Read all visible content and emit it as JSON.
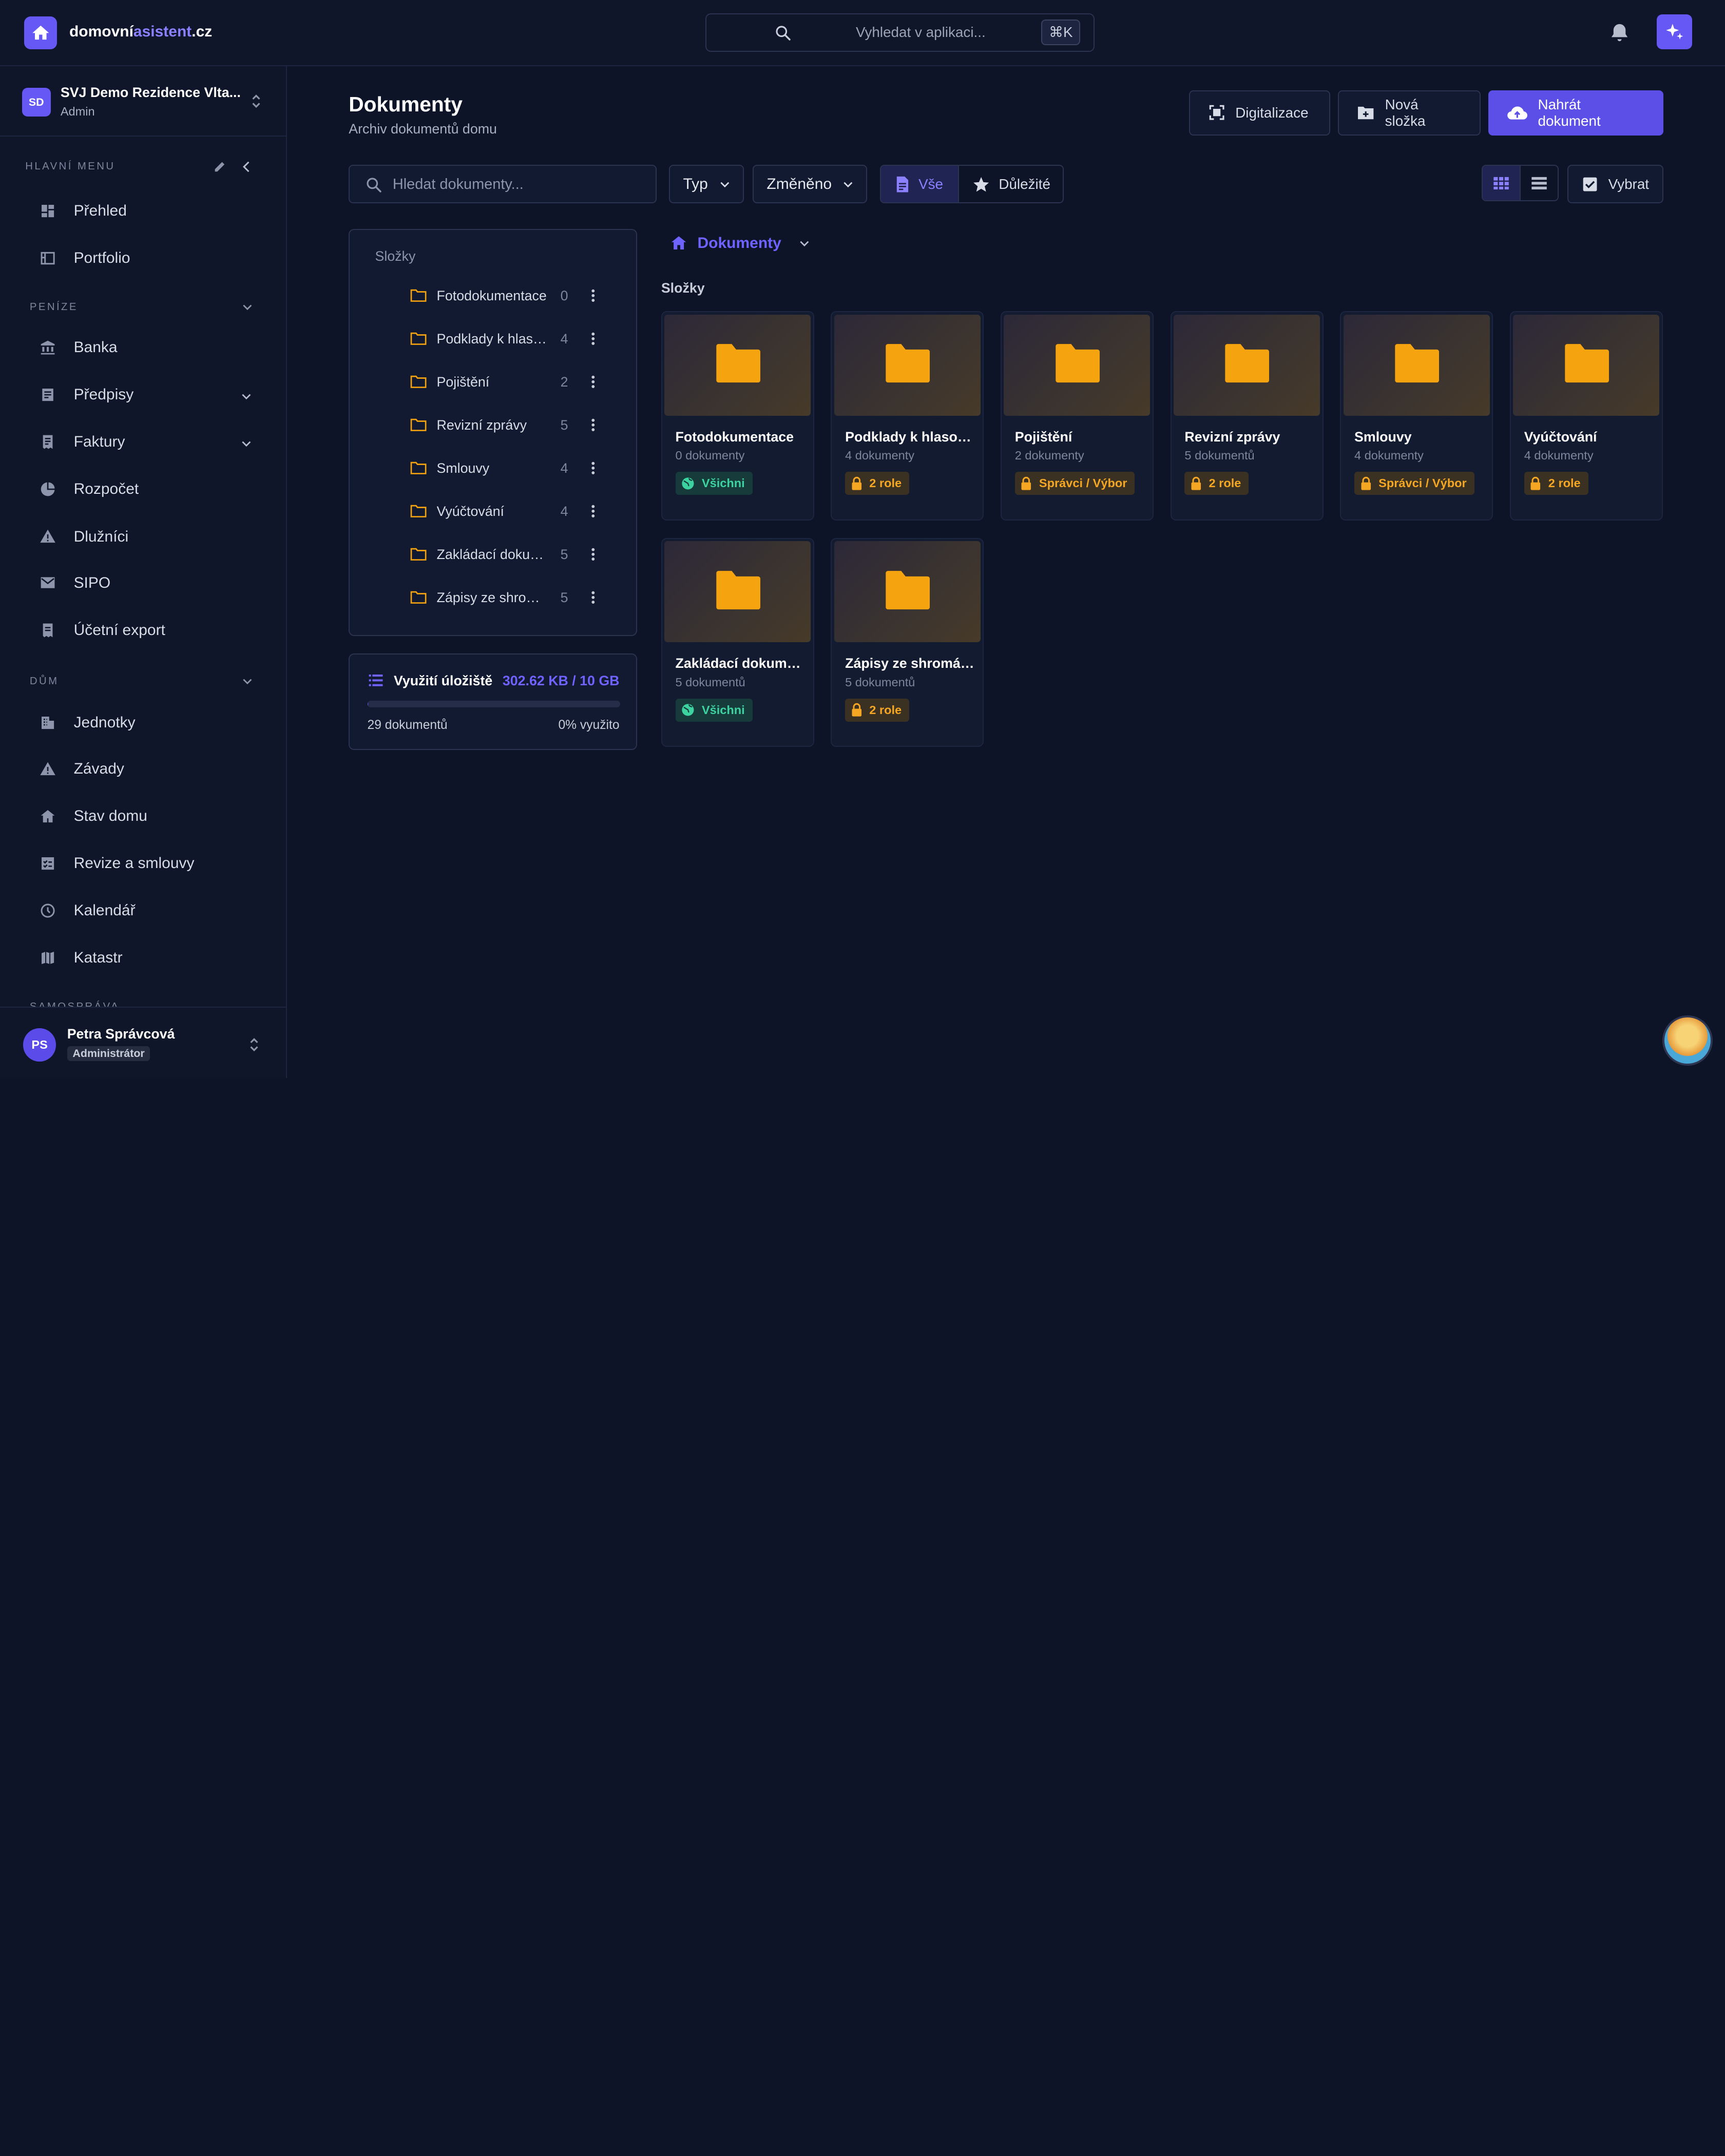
{
  "brand": {
    "name_a": "domovní",
    "name_b": "asistent",
    "name_c": ".cz"
  },
  "top": {
    "search_placeholder": "Vyhledat v aplikaci...",
    "shortcut": "⌘K"
  },
  "org": {
    "initials": "SD",
    "name": "SVJ Demo Rezidence Vlta...",
    "role": "Admin"
  },
  "sidebar": {
    "main_label": "HLAVNÍ MENU",
    "main": [
      {
        "label": "Přehled",
        "icon": "dashboard-icon"
      },
      {
        "label": "Portfolio",
        "icon": "portfolio-icon"
      }
    ],
    "money_label": "PENÍZE",
    "money": [
      {
        "label": "Banka",
        "icon": "bank-icon"
      },
      {
        "label": "Předpisy",
        "icon": "list-icon"
      },
      {
        "label": "Faktury",
        "icon": "receipt-icon"
      },
      {
        "label": "Rozpočet",
        "icon": "pie-chart-icon"
      },
      {
        "label": "Dlužníci",
        "icon": "warning-icon"
      },
      {
        "label": "SIPO",
        "icon": "mail-icon"
      },
      {
        "label": "Účetní export",
        "icon": "export-icon"
      }
    ],
    "house_label": "DŮM",
    "house": [
      {
        "label": "Jednotky",
        "icon": "building-icon"
      },
      {
        "label": "Závady",
        "icon": "warning-icon"
      },
      {
        "label": "Stav domu",
        "icon": "house-icon"
      },
      {
        "label": "Revize a smlouvy",
        "icon": "checklist-icon"
      },
      {
        "label": "Kalendář",
        "icon": "clock-icon"
      },
      {
        "label": "Katastr",
        "icon": "map-icon"
      }
    ],
    "gov_label": "SAMOSPRÁVA"
  },
  "user": {
    "initials": "PS",
    "name": "Petra Správcová",
    "role": "Administrátor"
  },
  "page": {
    "title": "Dokumenty",
    "subtitle": "Archiv dokumentů domu"
  },
  "actions": {
    "digitize": "Digitalizace",
    "new_folder": "Nová složka",
    "upload": "Nahrát dokument"
  },
  "filters": {
    "search_placeholder": "Hledat dokumenty...",
    "type": "Typ",
    "changed": "Změněno",
    "all": "Vše",
    "important": "Důležité",
    "select": "Vybrat"
  },
  "tree": {
    "header": "Složky",
    "items": [
      {
        "name": "Fotodokumentace",
        "count": "0"
      },
      {
        "name": "Podklady k hlaso...",
        "count": "4"
      },
      {
        "name": "Pojištění",
        "count": "2"
      },
      {
        "name": "Revizní zprávy",
        "count": "5"
      },
      {
        "name": "Smlouvy",
        "count": "4"
      },
      {
        "name": "Vyúčtování",
        "count": "4"
      },
      {
        "name": "Zakládací dokum...",
        "count": "5"
      },
      {
        "name": "Zápisy ze shrom...",
        "count": "5"
      }
    ]
  },
  "storage": {
    "title": "Využití úložiště",
    "value": "302.62 KB / 10 GB",
    "count": "29 dokumentů",
    "percent_text": "0% využito",
    "used_fraction": 0.002
  },
  "breadcrumb": {
    "label": "Dokumenty"
  },
  "grid": {
    "label": "Složky",
    "cards": [
      {
        "name": "Fotodokumentace",
        "count": "0 dokumenty",
        "tag": "Všichni",
        "tag_type": "public"
      },
      {
        "name": "Podklady k hlasov...",
        "count": "4 dokumenty",
        "tag": "2 role",
        "tag_type": "lock"
      },
      {
        "name": "Pojištění",
        "count": "2 dokumenty",
        "tag": "Správci / Výbor",
        "tag_type": "lock"
      },
      {
        "name": "Revizní zprávy",
        "count": "5 dokumentů",
        "tag": "2 role",
        "tag_type": "lock"
      },
      {
        "name": "Smlouvy",
        "count": "4 dokumenty",
        "tag": "Správci / Výbor",
        "tag_type": "lock"
      },
      {
        "name": "Vyúčtování",
        "count": "4 dokumenty",
        "tag": "2 role",
        "tag_type": "lock"
      },
      {
        "name": "Zakládací dokume...",
        "count": "5 dokumentů",
        "tag": "Všichni",
        "tag_type": "public"
      },
      {
        "name": "Zápisy ze shromáž...",
        "count": "5 dokumentů",
        "tag": "2 role",
        "tag_type": "lock"
      }
    ]
  },
  "colors": {
    "accent": "#6558f5",
    "folder": "#f5a30f",
    "public_tag": "#3cd3a0",
    "lock_tag": "#f5a623"
  }
}
